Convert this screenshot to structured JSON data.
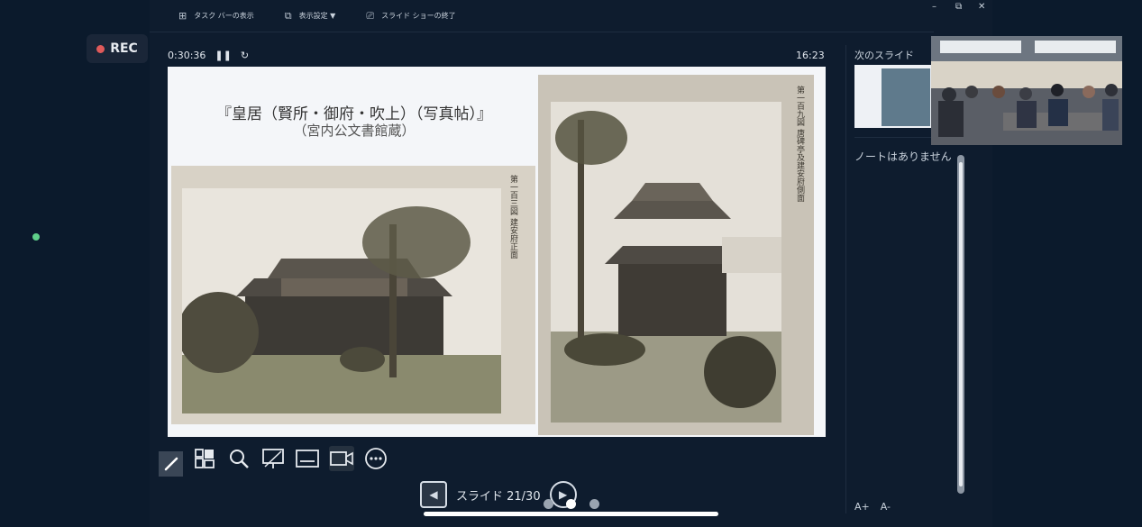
{
  "recording": {
    "label": "REC"
  },
  "toolbar": {
    "taskbar_label": "タスク バーの表示",
    "display_settings_label": "表示設定 ▼",
    "end_show_label": "スライド ショーの終了"
  },
  "window_controls": {
    "minimize": "–",
    "restore": "⧉",
    "close": "✕"
  },
  "timer": {
    "elapsed": "0:30:36",
    "pause_icon": "pause-icon",
    "reset_icon": "reset-icon"
  },
  "clock": "16:23",
  "slide": {
    "title": "『皇居（賢所・御府・吹上）（写真帖）』",
    "subtitle": "（宮内公文書館蔵）",
    "left_photo_caption": "第一百三図 建安府正面",
    "right_photo_caption": "第一百九図 唐碑亭及建安府側面"
  },
  "tools": [
    "pen-icon",
    "slide-grid-icon",
    "zoom-icon",
    "screen-icon",
    "subtitles-icon",
    "camera-icon",
    "more-icon"
  ],
  "navigation": {
    "slide_counter": "スライド 21/30"
  },
  "side_panel": {
    "next_slide_label": "次のスライド",
    "notes_text": "ノートはありません",
    "font_increase": "A+",
    "font_decrease": "A-"
  },
  "colors": {
    "background": "#0b1a2c",
    "rec_dot": "#e05a5a",
    "status_dot": "#5fd08a"
  }
}
